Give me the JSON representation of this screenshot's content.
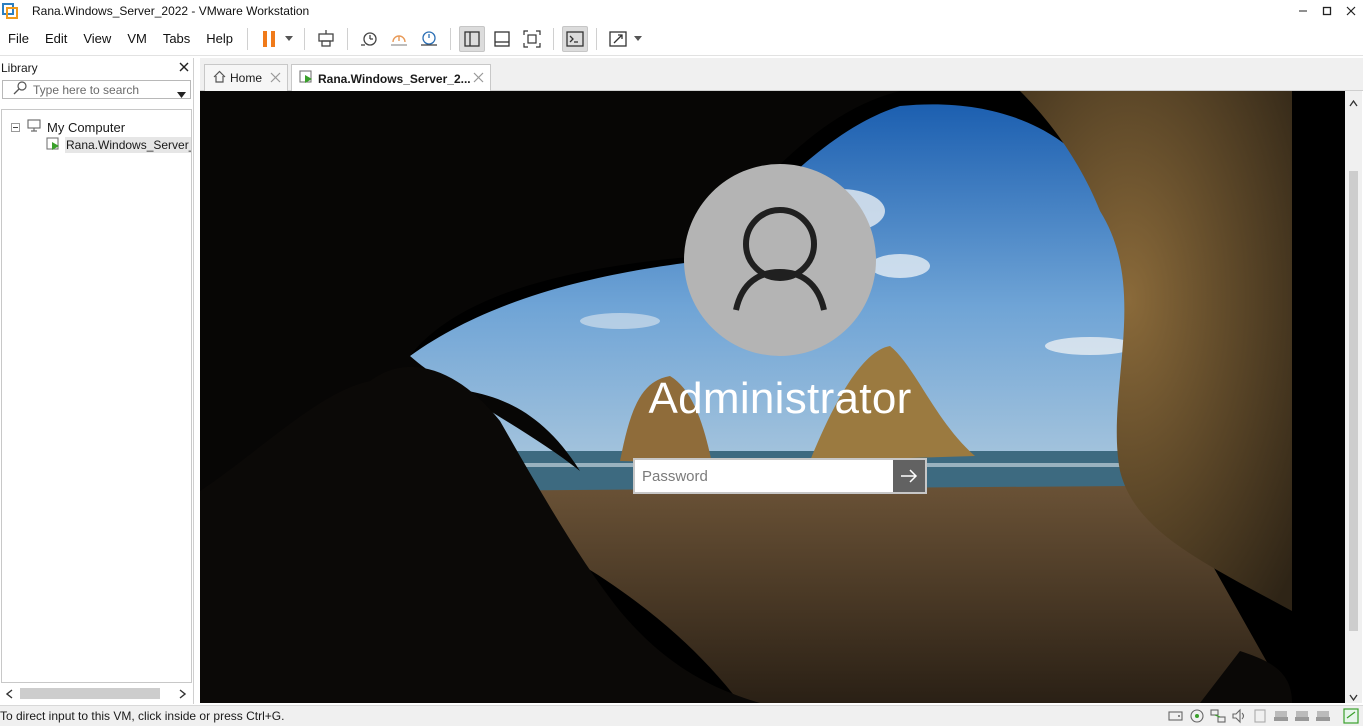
{
  "window": {
    "title": "Rana.Windows_Server_2022 - VMware Workstation"
  },
  "menu": {
    "file": "File",
    "edit": "Edit",
    "view": "View",
    "vm": "VM",
    "tabs": "Tabs",
    "help": "Help"
  },
  "library": {
    "title": "Library",
    "search_placeholder": "Type here to search",
    "tree": [
      {
        "label": "My Computer"
      },
      {
        "label": "Rana.Windows_Server_2"
      }
    ]
  },
  "tabs": [
    {
      "label": "Home"
    },
    {
      "label": "Rana.Windows_Server_2..."
    }
  ],
  "login": {
    "user": "Administrator",
    "password_placeholder": "Password"
  },
  "status": {
    "message": "To direct input to this VM, click inside or press Ctrl+G."
  },
  "colors": {
    "pause_accent": "#f07a1a",
    "vm_background": "#000000",
    "avatar": "#b4b4b4"
  }
}
